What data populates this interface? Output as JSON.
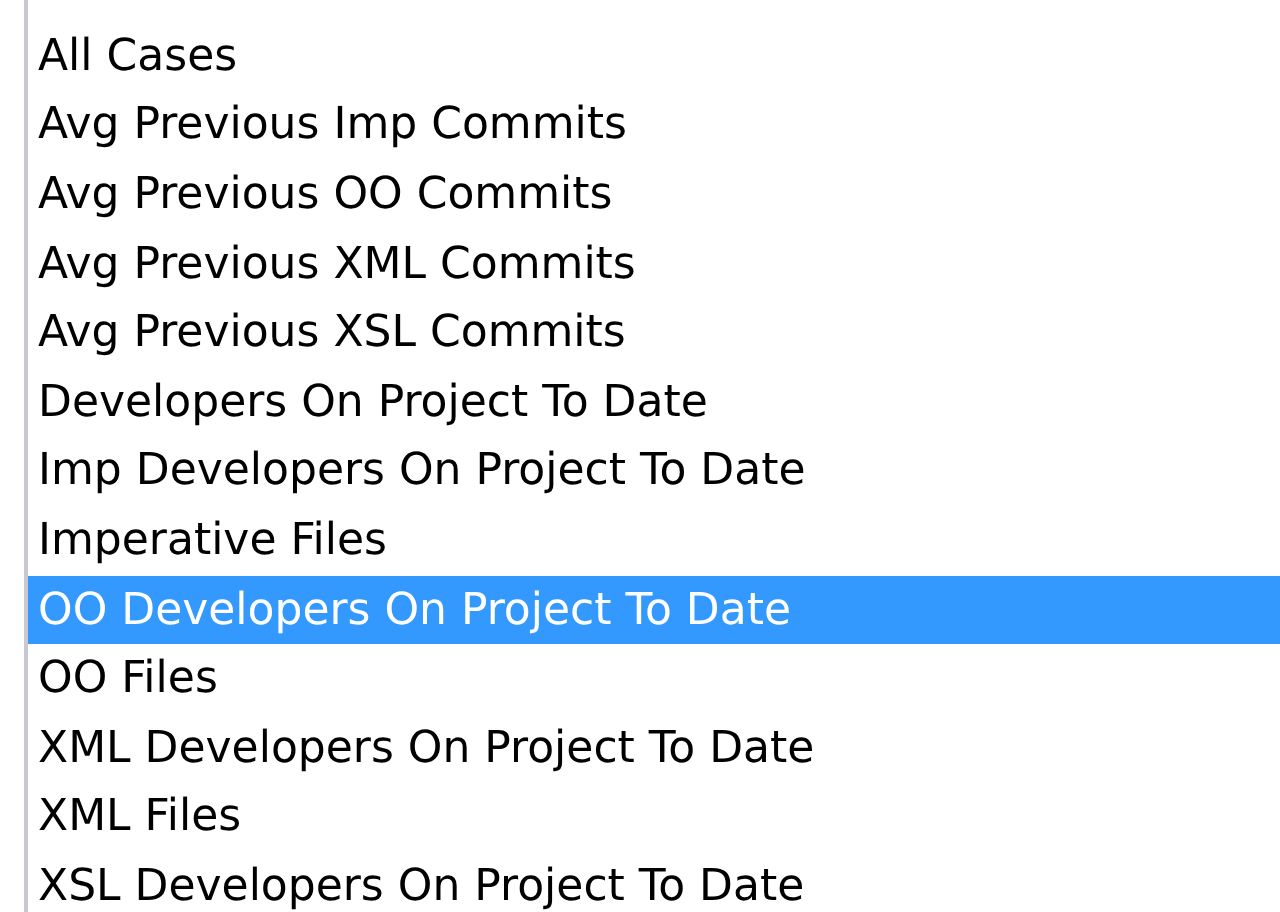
{
  "list": {
    "items": [
      {
        "label": "All Cases",
        "selected": false
      },
      {
        "label": "Avg Previous Imp Commits",
        "selected": false
      },
      {
        "label": "Avg Previous OO Commits",
        "selected": false
      },
      {
        "label": "Avg Previous XML Commits",
        "selected": false
      },
      {
        "label": "Avg Previous XSL Commits",
        "selected": false
      },
      {
        "label": "Developers On Project To Date",
        "selected": false
      },
      {
        "label": "Imp Developers On Project To Date",
        "selected": false
      },
      {
        "label": "Imperative Files",
        "selected": false
      },
      {
        "label": "OO Developers On Project To Date",
        "selected": true
      },
      {
        "label": "OO Files",
        "selected": false
      },
      {
        "label": "XML Developers On Project To Date",
        "selected": false
      },
      {
        "label": "XML Files",
        "selected": false
      },
      {
        "label": "XSL Developers On Project To Date",
        "selected": false
      }
    ]
  }
}
